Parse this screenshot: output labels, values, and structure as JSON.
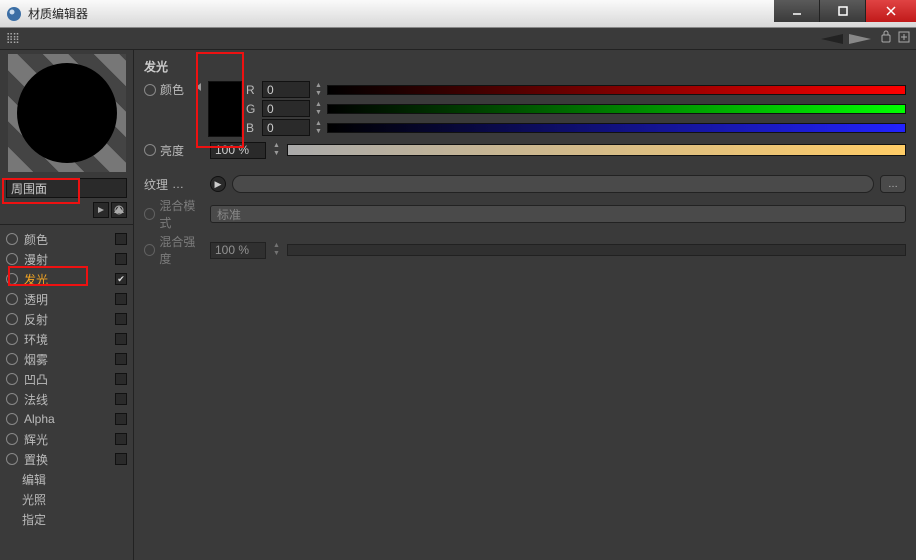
{
  "window": {
    "title": "材质编辑器"
  },
  "material": {
    "name": "周围面"
  },
  "channels": [
    {
      "key": "color",
      "label": "颜色",
      "checked": false
    },
    {
      "key": "diffuse",
      "label": "漫射",
      "checked": false
    },
    {
      "key": "lumin",
      "label": "发光",
      "checked": true,
      "active": true
    },
    {
      "key": "trans",
      "label": "透明",
      "checked": false
    },
    {
      "key": "refl",
      "label": "反射",
      "checked": false
    },
    {
      "key": "env",
      "label": "环境",
      "checked": false
    },
    {
      "key": "fog",
      "label": "烟雾",
      "checked": false
    },
    {
      "key": "bump",
      "label": "凹凸",
      "checked": false
    },
    {
      "key": "normal",
      "label": "法线",
      "checked": false
    },
    {
      "key": "alpha",
      "label": "Alpha",
      "checked": false
    },
    {
      "key": "glow",
      "label": "辉光",
      "checked": false
    },
    {
      "key": "displ",
      "label": "置换",
      "checked": false
    }
  ],
  "sub_items": [
    {
      "label": "编辑"
    },
    {
      "label": "光照"
    },
    {
      "label": "指定"
    }
  ],
  "panel": {
    "title": "发光",
    "labels": {
      "color": "颜色",
      "brightness": "亮度",
      "texture": "纹理",
      "blend_mode": "混合模式",
      "blend_strength": "混合强度"
    },
    "rgb": {
      "r": {
        "ch": "R",
        "val": "0"
      },
      "g": {
        "ch": "G",
        "val": "0"
      },
      "b": {
        "ch": "B",
        "val": "0"
      }
    },
    "brightness_value": "100 %",
    "blend_mode_value": "标准",
    "blend_strength_value": "100 %"
  }
}
